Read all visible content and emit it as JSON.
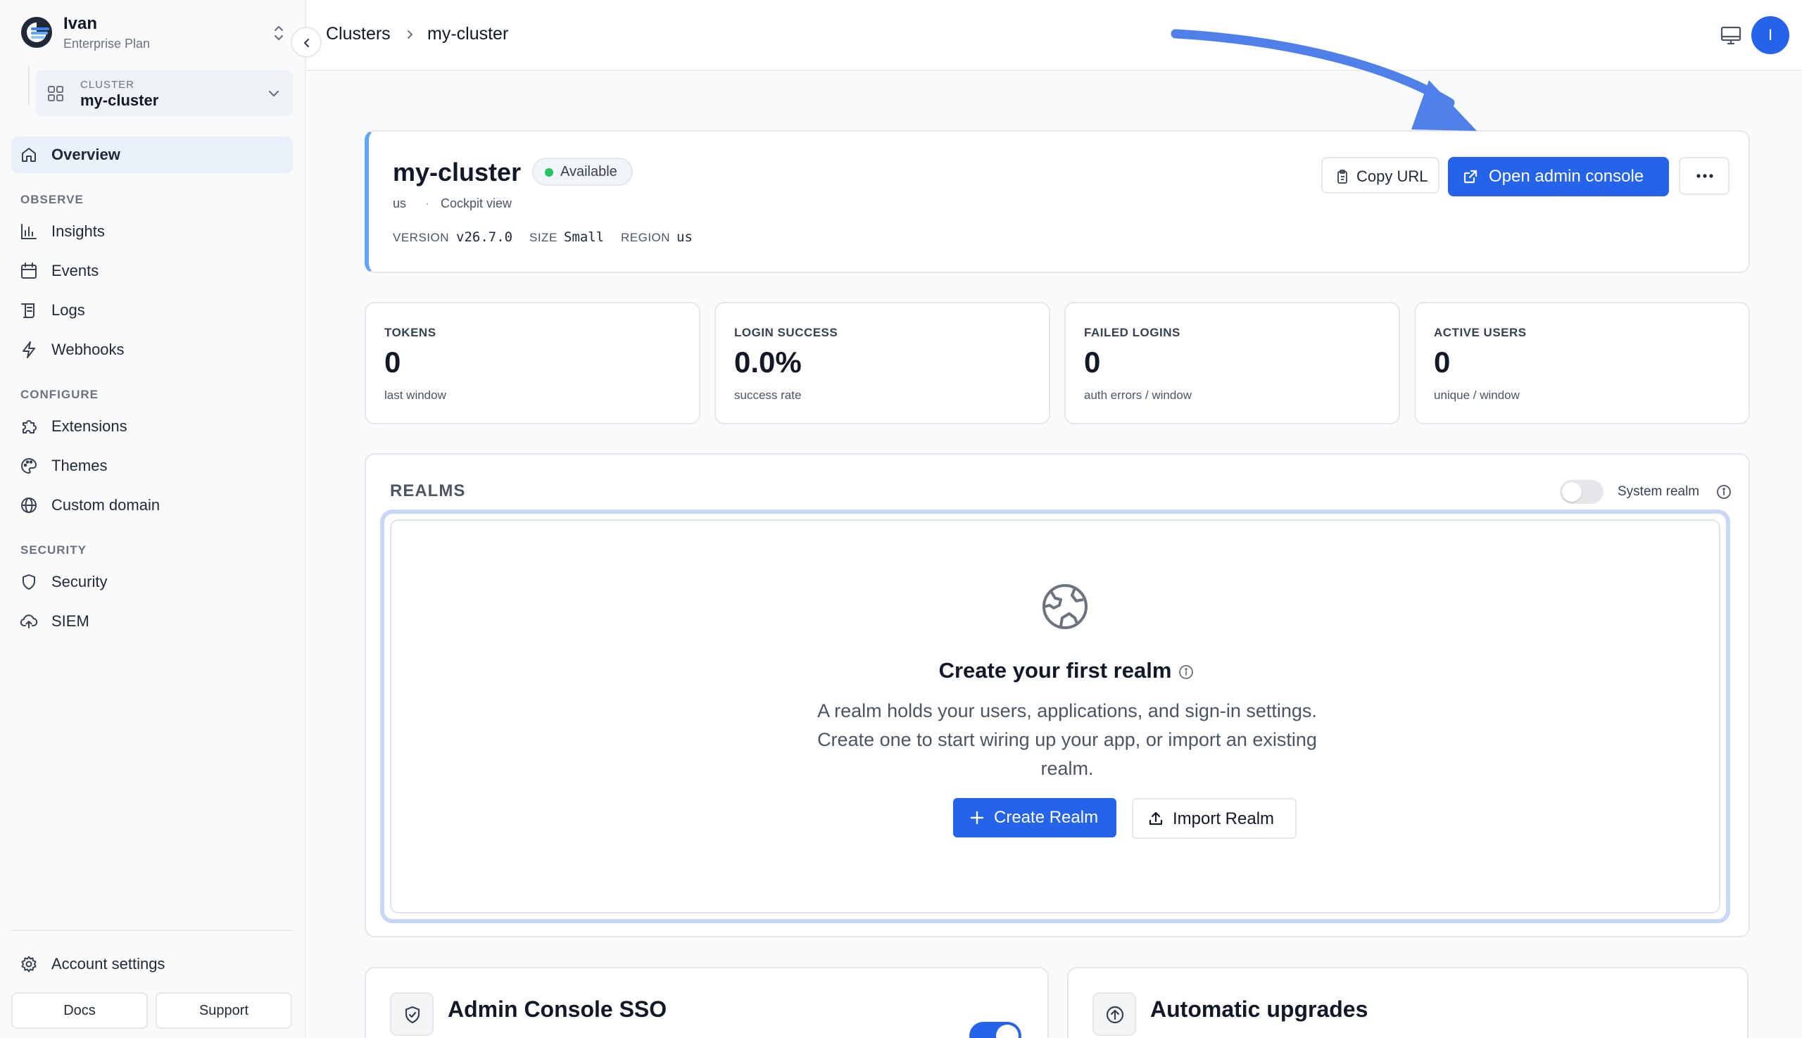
{
  "org": {
    "name": "Ivan",
    "plan": "Enterprise Plan"
  },
  "cluster_selector": {
    "label": "CLUSTER",
    "value": "my-cluster"
  },
  "nav": {
    "overview": "Overview",
    "observe_heading": "OBSERVE",
    "insights": "Insights",
    "events": "Events",
    "logs": "Logs",
    "webhooks": "Webhooks",
    "configure_heading": "CONFIGURE",
    "extensions": "Extensions",
    "themes": "Themes",
    "custom_domain": "Custom domain",
    "security_heading": "SECURITY",
    "security": "Security",
    "siem": "SIEM",
    "account_settings": "Account settings",
    "docs": "Docs",
    "support": "Support"
  },
  "breadcrumb": {
    "root": "Clusters",
    "current": "my-cluster"
  },
  "user": {
    "initial": "I"
  },
  "cluster": {
    "name": "my-cluster",
    "status": "Available",
    "region_short": "us",
    "separator": "·",
    "view": "Cockpit view",
    "version_label": "VERSION",
    "version": "v26.7.0",
    "size_label": "SIZE",
    "size": "Small",
    "region_label": "REGION",
    "region": "us",
    "copy_url": "Copy URL",
    "open_admin": "Open admin console"
  },
  "stats": [
    {
      "label": "TOKENS",
      "value": "0",
      "sub": "last window"
    },
    {
      "label": "LOGIN SUCCESS",
      "value": "0.0%",
      "sub": "success rate"
    },
    {
      "label": "FAILED LOGINS",
      "value": "0",
      "sub": "auth errors / window"
    },
    {
      "label": "ACTIVE USERS",
      "value": "0",
      "sub": "unique / window"
    }
  ],
  "realms": {
    "title": "REALMS",
    "system_realm_label": "System realm",
    "system_realm_enabled": false,
    "empty_title": "Create your first realm",
    "empty_desc": "A realm holds your users, applications, and sign-in settings. Create one to start wiring up your app, or import an existing realm.",
    "create": "Create Realm",
    "import": "Import Realm"
  },
  "bottom_cards": {
    "sso_title": "Admin Console SSO",
    "sso_enabled": true,
    "upgrades_title": "Automatic upgrades"
  },
  "colors": {
    "accent": "#2563eb",
    "status_available": "#22c55e",
    "annotation_arrow": "#4f7fe8"
  }
}
